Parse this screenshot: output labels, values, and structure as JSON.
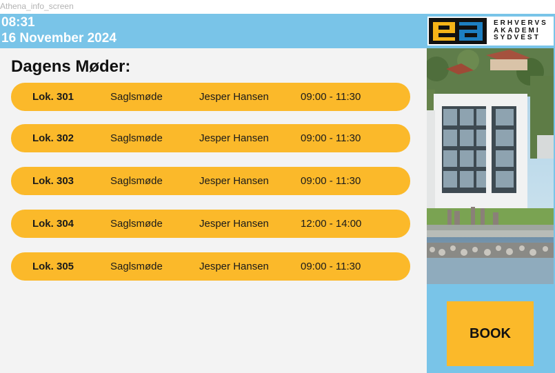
{
  "window": {
    "label": "Athena_info_screen"
  },
  "header": {
    "time": "08:31",
    "date": "16 November 2024",
    "logo": {
      "words": [
        "ERHVERVS",
        "AKADEMI",
        "SYDVEST"
      ],
      "mark_colors": [
        "#111111",
        "#f6b418",
        "#1d7fc2"
      ]
    }
  },
  "meetings": {
    "title": "Dagens Møder:",
    "rows": [
      {
        "room": "Lok. 301",
        "type": "Saglsmøde",
        "person": "Jesper Hansen",
        "time": "09:00 - 11:30"
      },
      {
        "room": "Lok. 302",
        "type": "Saglsmøde",
        "person": "Jesper Hansen",
        "time": "09:00 - 11:30"
      },
      {
        "room": "Lok. 303",
        "type": "Saglsmøde",
        "person": "Jesper Hansen",
        "time": "09:00 - 11:30"
      },
      {
        "room": "Lok. 304",
        "type": "Saglsmøde",
        "person": "Jesper Hansen",
        "time": "12:00 - 14:00"
      },
      {
        "room": "Lok. 305",
        "type": "Saglsmøde",
        "person": "Jesper Hansen",
        "time": "09:00 - 11:30"
      }
    ]
  },
  "sidebar": {
    "book_label": "BOOK"
  },
  "colors": {
    "header": "#79c4e8",
    "row": "#fbb92a",
    "accent_text": "#ffffff"
  }
}
